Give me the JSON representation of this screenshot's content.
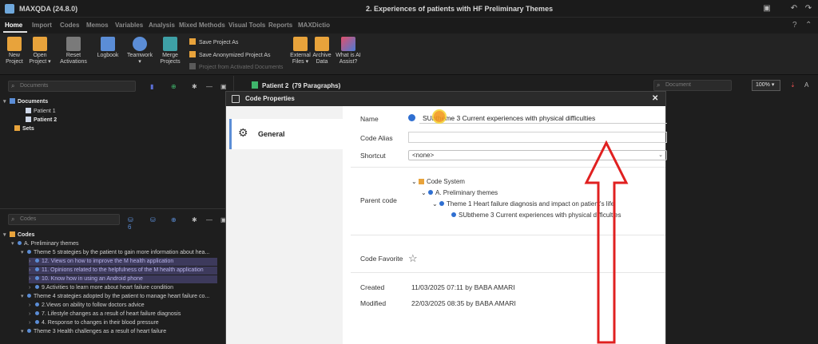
{
  "app": {
    "title": "MAXQDA (24.8.0)",
    "document_title": "2. Experiences of patients with HF Preliminary Themes"
  },
  "ribbon_tabs": [
    "Home",
    "Import",
    "Codes",
    "Memos",
    "Variables",
    "Analysis",
    "Mixed Methods",
    "Visual Tools",
    "Reports",
    "MAXDictio"
  ],
  "ribbon_buttons": [
    {
      "label": "New\nProject",
      "icon": "new-project-icon"
    },
    {
      "label": "Open\nProject ▾",
      "icon": "open-project-icon"
    },
    {
      "label": "Reset\nActivations",
      "icon": "reset-activations-icon"
    },
    {
      "label": "Logbook",
      "icon": "logbook-icon"
    },
    {
      "label": "Teamwork\n▾",
      "icon": "teamwork-icon"
    },
    {
      "label": "Merge\nProjects",
      "icon": "merge-projects-icon"
    },
    {
      "label": "External\nFiles ▾",
      "icon": "external-files-icon"
    },
    {
      "label": "Archive\nData",
      "icon": "archive-data-icon"
    },
    {
      "label": "What is AI\nAssist?",
      "icon": "ai-assist-icon"
    }
  ],
  "ribbon_small": [
    "Save Project As",
    "Save Anonymized Project As",
    "Project from Activated Documents"
  ],
  "documents_panel": {
    "search_placeholder": "Documents",
    "root": "Documents",
    "items": [
      "Patient 1",
      "Patient 2"
    ],
    "sets": "Sets"
  },
  "codes_panel": {
    "search_placeholder": "Codes",
    "count_label": "6",
    "root": "Codes",
    "rows": [
      "A. Preliminary themes",
      "Theme 5 strategies by the patient to gain more information about hea...",
      "12. Views on how to improve the M health application",
      "11. Opinions related to the helpfulness of the M health application",
      "10. Know how in using an Android phone",
      "9.Activities to learn more about heart failure condition",
      "Theme 4 strategies adopted by the patient to manage heart failure co...",
      "2.Views on ability to follow doctors advice",
      "7. Lifestyle changes as a result of heart failure diagnosis",
      "4. Response to changes in their blood pressure",
      "Theme 3 Health challenges as a result of heart failure"
    ]
  },
  "document_pane": {
    "title": "Patient 2",
    "paragraphs": "(79 Paragraphs)",
    "search_placeholder": "Document",
    "zoom": "100%"
  },
  "dialog": {
    "title": "Code Properties",
    "nav_general": "General",
    "labels": {
      "name": "Name",
      "alias": "Code Alias",
      "shortcut": "Shortcut",
      "parent": "Parent code",
      "favorite": "Code Favorite",
      "created": "Created",
      "modified": "Modified"
    },
    "name_value": "SUbtheme 3 Current experiences with physical difficulties",
    "shortcut_value": "<none>",
    "parent_tree": [
      "Code System",
      "A. Preliminary themes",
      "Theme 1 Heart failure diagnosis and impact on patient's life",
      "SUbtheme 3 Current experiences with physical difficulties"
    ],
    "created_value": "11/03/2025 07:11 by BABA AMARI",
    "modified_value": "22/03/2025 08:35 by BABA  AMARI"
  },
  "colors": {
    "accent": "#5b8dd6",
    "code_blue": "#2f6fd1",
    "annotation_red": "#e02020",
    "cursor_orange": "#f39a1f"
  }
}
